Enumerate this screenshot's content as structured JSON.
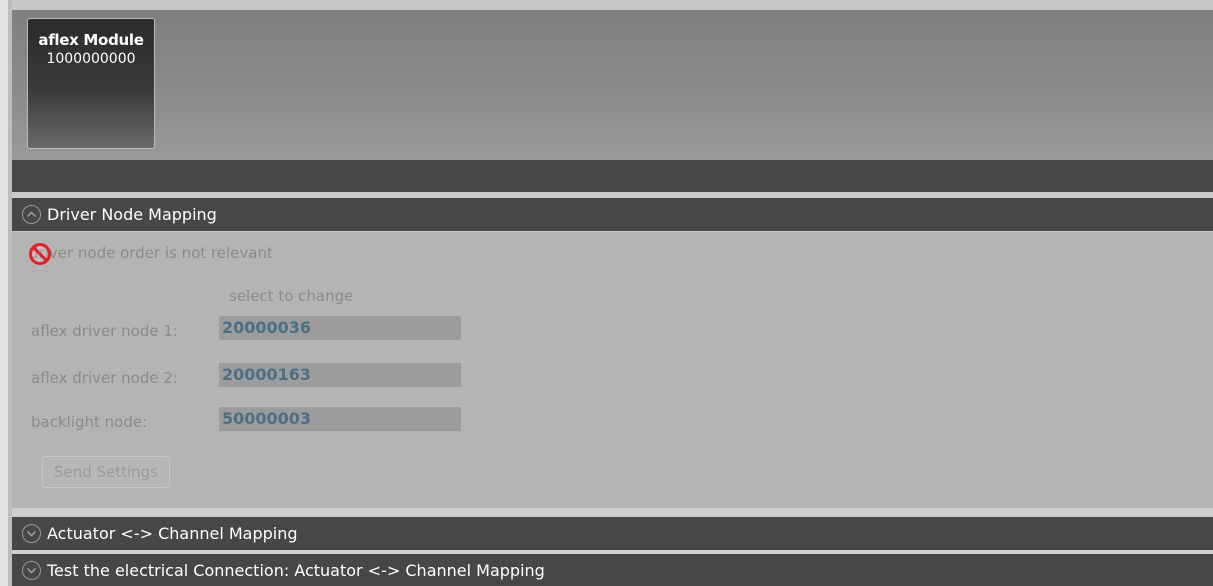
{
  "module": {
    "title": "aflex Module",
    "id": "1000000000"
  },
  "sections": {
    "driver_mapping": {
      "title": "Driver Node Mapping",
      "expanded": true,
      "note": "driver node order is not relevant",
      "select_hint": "select to change",
      "rows": [
        {
          "label": "aflex driver node 1:",
          "value": "20000036"
        },
        {
          "label": "aflex driver node 2:",
          "value": "20000163"
        },
        {
          "label": "backlight node:",
          "value": "50000003"
        }
      ],
      "send_button": "Send Settings"
    },
    "actuator_mapping": {
      "title": "Actuator <-> Channel Mapping",
      "expanded": false
    },
    "electrical_test": {
      "title": "Test the electrical Connection: Actuator <-> Channel Mapping",
      "expanded": false
    }
  },
  "colors": {
    "header_bg": "#474747",
    "panel_bg": "#b4b4b4",
    "node_value": "#4d6f84",
    "no_entry_icon": "#e0202a"
  },
  "icons": [
    "chevron-up-icon",
    "chevron-down-icon",
    "no-entry-cursor-icon"
  ]
}
